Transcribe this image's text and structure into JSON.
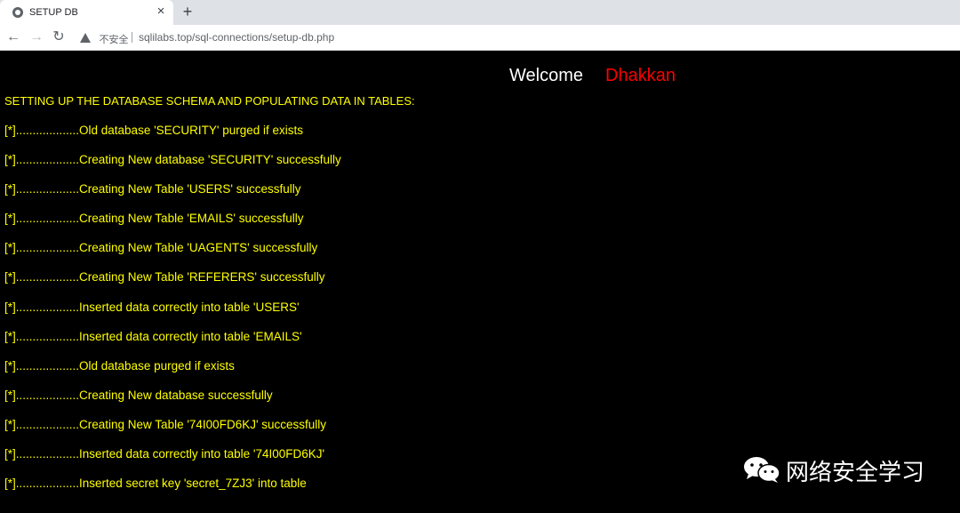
{
  "browser": {
    "tab_title": "SETUP DB",
    "tab_close": "×",
    "new_tab": "+",
    "security_label": "不安全",
    "url": "sqlilabs.top/sql-connections/setup-db.php"
  },
  "page": {
    "welcome": "Welcome",
    "welcome_name": "Dhakkan",
    "heading": "SETTING UP THE DATABASE SCHEMA AND POPULATING DATA IN TABLES:",
    "log": [
      "[*]...................Old database 'SECURITY' purged if exists",
      "[*]...................Creating New database 'SECURITY' successfully",
      "[*]...................Creating New Table 'USERS' successfully",
      "[*]...................Creating New Table 'EMAILS' successfully",
      "[*]...................Creating New Table 'UAGENTS' successfully",
      "[*]...................Creating New Table 'REFERERS' successfully",
      "[*]...................Inserted data correctly into table 'USERS'",
      "[*]...................Inserted data correctly into table 'EMAILS'",
      "[*]...................Old database purged if exists",
      "[*]...................Creating New database successfully",
      "[*]...................Creating New Table '74I00FD6KJ' successfully",
      "[*]...................Inserted data correctly into table '74I00FD6KJ'",
      "[*]...................Inserted secret key 'secret_7ZJ3' into table"
    ]
  },
  "watermark": {
    "text": "网络安全学习",
    "icon": "wechat-icon"
  },
  "colors": {
    "page_bg": "#000000",
    "log_text": "#ffff00",
    "welcome": "#ffffff",
    "welcome_name": "#ff0000"
  }
}
